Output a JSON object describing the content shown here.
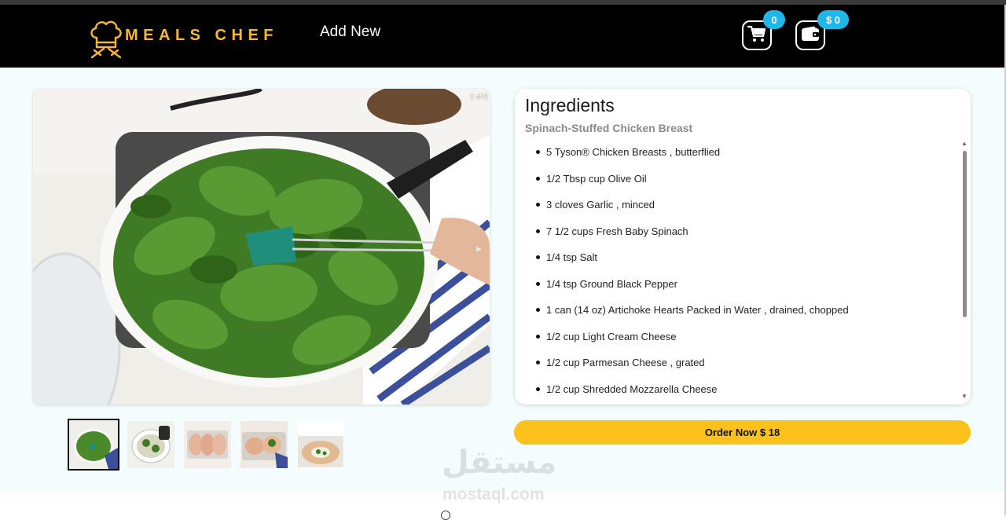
{
  "header": {
    "brand": "MEALS CHEF",
    "nav_add_new": "Add New",
    "cart_count": "0",
    "wallet_amount": "$ 0",
    "logo_icon": "chef-hat-icon",
    "cart_icon": "shopping-cart-icon",
    "wallet_icon": "wallet-icon"
  },
  "gallery": {
    "counter": "1 of 5",
    "next_icon": "chevron-right-icon",
    "thumbnails": [
      "thumbnail-1",
      "thumbnail-2",
      "thumbnail-3",
      "thumbnail-4",
      "thumbnail-5"
    ],
    "active_index": 0
  },
  "ingredients": {
    "title": "Ingredients",
    "recipe_name": "Spinach-Stuffed Chicken Breast",
    "items": [
      "5 Tyson® Chicken Breasts , butterflied",
      "1/2 Tbsp cup Olive Oil",
      "3 cloves Garlic , minced",
      "7 1/2 cups Fresh Baby Spinach",
      "1/4 tsp Salt",
      "1/4 tsp Ground Black Pepper",
      "1 can (14 oz) Artichoke Hearts Packed in Water , drained, chopped",
      "1/2 cup Light Cream Cheese",
      "1/2 cup Parmesan Cheese , grated",
      "1/2 cup Shredded Mozzarella Cheese"
    ]
  },
  "order": {
    "label": "Order Now $ 18"
  },
  "watermark": {
    "arabic": "مستقل",
    "latin": "mostaql.com"
  },
  "colors": {
    "brand_gold": "#f5b82e",
    "badge_blue": "#1fb6e8",
    "order_yellow": "#fcc21b",
    "navbar_black": "#000000",
    "page_bg": "#f4fcfe"
  }
}
